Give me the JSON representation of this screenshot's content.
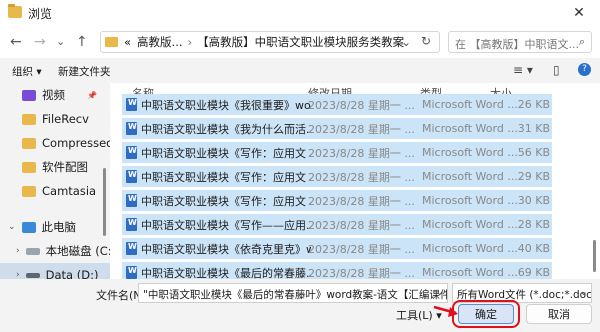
{
  "window": {
    "title": "浏览",
    "close": "✕"
  },
  "nav": {
    "back": "←",
    "forward": "→",
    "down": "⌄",
    "up": "↑"
  },
  "address": {
    "prefix": "«",
    "crumb1": "高教版...",
    "separator": "›",
    "crumb2": "【高教版】中职语文职业模块服务类教案",
    "dropdown": "⌄",
    "refresh": "↻"
  },
  "search": {
    "placeholder": "在 【高教版】中职语文...",
    "icon": "⌕"
  },
  "toolbar": {
    "organize": "组织 ▾",
    "new_folder": "新建文件夹",
    "view": "≡ ▾",
    "pane": "▯",
    "help": "?"
  },
  "sidebar": {
    "items": [
      {
        "label": "视频",
        "pin": "📌"
      },
      {
        "label": "FileRecv"
      },
      {
        "label": "Compressed"
      },
      {
        "label": "软件配图"
      },
      {
        "label": "Camtasia"
      },
      {
        "label": "此电脑"
      },
      {
        "label": "本地磁盘 (C:)"
      },
      {
        "label": "Data (D:)"
      }
    ]
  },
  "columns": {
    "name": "名称",
    "date": "修改日期",
    "type": "类型",
    "size": "大小"
  },
  "files": [
    {
      "name": "中职语文职业模块《我很重要》wor...",
      "date": "2023/8/28 星期一 ...",
      "type": "Microsoft Word ...",
      "size": "26 KB"
    },
    {
      "name": "中职语文职业模块《我为什么而活...",
      "date": "2023/8/28 星期一 ...",
      "type": "Microsoft Word ...",
      "size": "31 KB"
    },
    {
      "name": "中职语文职业模块《写作：应用文 ...",
      "date": "2023/8/28 星期一 ...",
      "type": "Microsoft Word ...",
      "size": "56 KB"
    },
    {
      "name": "中职语文职业模块《写作：应用文 ...",
      "date": "2023/8/28 星期一 ...",
      "type": "Microsoft Word ...",
      "size": "29 KB"
    },
    {
      "name": "中职语文职业模块《写作：应用文 ...",
      "date": "2023/8/28 星期一 ...",
      "type": "Microsoft Word ...",
      "size": "30 KB"
    },
    {
      "name": "中职语文职业模块《写作——应用...",
      "date": "2023/8/28 星期一 ...",
      "type": "Microsoft Word ...",
      "size": "28 KB"
    },
    {
      "name": "中职语文职业模块《依奇克里克》w...",
      "date": "2023/8/28 星期一 ...",
      "type": "Microsoft Word ...",
      "size": "40 KB"
    },
    {
      "name": "中职语文职业模块《最后的常春藤...",
      "date": "2023/8/28 星期一 ...",
      "type": "Microsoft Word ...",
      "size": "69 KB"
    }
  ],
  "bottom": {
    "filename_label": "文件名(N):",
    "filename_value": "\"中职语文职业模块《最后的常春藤叶》word教案-语文【汇编课件教育辅】.doc",
    "filetype": "所有Word文件 (*.doc;*.docx)",
    "dropdown": "⌄",
    "tools": "工具(L)  ▾",
    "ok": "确定",
    "cancel": "取消"
  },
  "colors": {
    "selection": "#cce4f7",
    "highlight": "#e0101c",
    "folder": "#e9b84a",
    "word": "#2f6cc2"
  }
}
